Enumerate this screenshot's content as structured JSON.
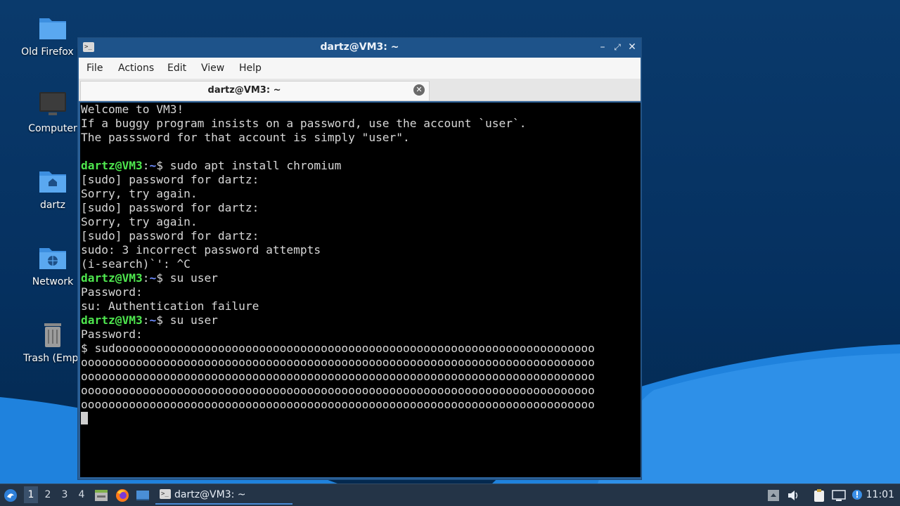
{
  "desktop": {
    "icons": [
      {
        "label": "Old Firefox D",
        "icon": "folder-icon"
      },
      {
        "label": "Computer",
        "icon": "computer-icon"
      },
      {
        "label": "dartz",
        "icon": "home-folder-icon"
      },
      {
        "label": "Network",
        "icon": "network-folder-icon"
      },
      {
        "label": "Trash (Empt",
        "icon": "trash-icon"
      }
    ]
  },
  "window": {
    "title": "dartz@VM3: ~",
    "menu": [
      "File",
      "Actions",
      "Edit",
      "View",
      "Help"
    ],
    "tab_label": "dartz@VM3: ~",
    "controls": {
      "minimize": "minimize-icon",
      "maximize": "maximize-icon",
      "close": "close-icon"
    }
  },
  "terminal": {
    "colors": {
      "user": "#4ee64e",
      "path": "#6e8cff",
      "text": "#d7d7d7",
      "background": "#000000"
    },
    "lines": [
      {
        "text": "Welcome to VM3!"
      },
      {
        "text": "If a buggy program insists on a password, use the account `user`."
      },
      {
        "text": "The passsword for that account is simply \"user\"."
      },
      {
        "text": ""
      },
      {
        "user": "dartz@VM3",
        "path": "~",
        "cmd": "$ sudo apt install chromium"
      },
      {
        "text": "[sudo] password for dartz:"
      },
      {
        "text": "Sorry, try again."
      },
      {
        "text": "[sudo] password for dartz:"
      },
      {
        "text": "Sorry, try again."
      },
      {
        "text": "[sudo] password for dartz:"
      },
      {
        "text": "sudo: 3 incorrect password attempts"
      },
      {
        "text": "(i-search)`': ^C"
      },
      {
        "user": "dartz@VM3",
        "path": "~",
        "cmd": "$ su user"
      },
      {
        "text": "Password:"
      },
      {
        "text": "su: Authentication failure"
      },
      {
        "user": "dartz@VM3",
        "path": "~",
        "cmd": "$ su user"
      },
      {
        "text": "Password:"
      },
      {
        "text": "$ sudoooooooooooooooooooooooooooooooooooooooooooooooooooooooooooooooooooooo"
      },
      {
        "text": "ooooooooooooooooooooooooooooooooooooooooooooooooooooooooooooooooooooooooooo"
      },
      {
        "text": "ooooooooooooooooooooooooooooooooooooooooooooooooooooooooooooooooooooooooooo"
      },
      {
        "text": "ooooooooooooooooooooooooooooooooooooooooooooooooooooooooooooooooooooooooooo"
      },
      {
        "text": "ooooooooooooooooooooooooooooooooooooooooooooooooooooooooooooooooooooooooooo"
      }
    ]
  },
  "taskbar": {
    "workspaces": [
      "1",
      "2",
      "3",
      "4"
    ],
    "active_workspace": "1",
    "launchers": [
      "app-menu-icon",
      "file-manager-icon",
      "firefox-icon",
      "show-desktop-icon"
    ],
    "task": {
      "label": "dartz@VM3: ~",
      "icon": "terminal-icon"
    },
    "tray": [
      "tray-arrow-icon",
      "volume-icon",
      "clipboard-icon",
      "network-icon",
      "notification-icon"
    ],
    "clock": "11:01"
  }
}
